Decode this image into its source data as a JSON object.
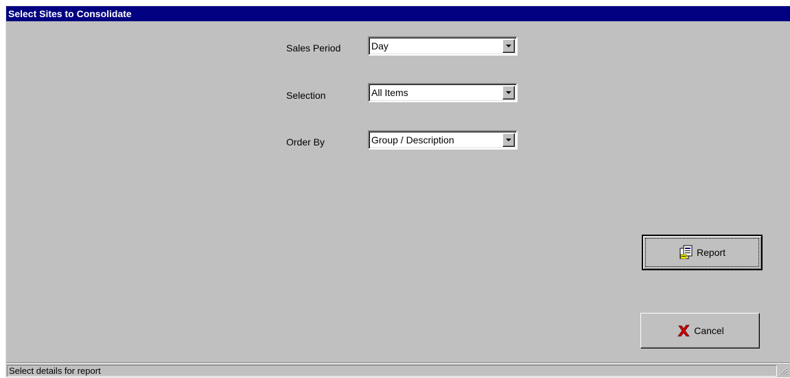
{
  "window": {
    "title": "Select Sites to Consolidate"
  },
  "form": {
    "sales_period": {
      "label": "Sales Period",
      "value": "Day"
    },
    "selection": {
      "label": "Selection",
      "value": "All Items"
    },
    "order_by": {
      "label": "Order By",
      "value": "Group / Description"
    }
  },
  "buttons": {
    "report_label": "Report",
    "report_icon": "report-icon",
    "cancel_label": "Cancel",
    "cancel_icon": "red-x-icon"
  },
  "status_bar": {
    "text": "Select details for report"
  },
  "colors": {
    "title_bar": "#000080",
    "face": "#c0c0c0",
    "cancel_x": "#cc0000"
  }
}
